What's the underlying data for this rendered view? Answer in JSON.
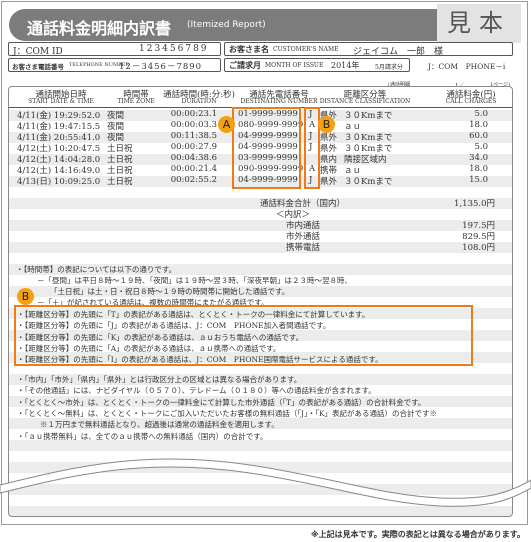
{
  "header": {
    "title": "通話料金明細内訳書",
    "subtitle": "(Itemized Report)",
    "sample_mark": "見本"
  },
  "info": {
    "jcom_id_label": "J：COM ID",
    "jcom_id_value": "123456789",
    "customer_label": "お客さま名",
    "customer_label_en": "CUSTOMER'S NAME",
    "customer_value": "ジェイコム　一郎　様",
    "phone_label": "お客さま電話番号",
    "phone_label_en": "TELEPHONE NUMBER",
    "phone_value": "12－3456－7890",
    "month_label": "ご請求月",
    "month_label_en": "MONTH OF ISSUE",
    "month_value": "2014年",
    "month_suffix": "5月請求分",
    "service": "J：COM　PHONE－i"
  },
  "page": {
    "section": "(通話明細",
    "current": "1／",
    "total": "1ページ)"
  },
  "columns": [
    {
      "ja": "通話開始日時",
      "en": "START DATE & TIME"
    },
    {
      "ja": "時間帯",
      "en": "TIME ZONE"
    },
    {
      "ja": "通話時間(時:分:秒)",
      "en": "DURATION"
    },
    {
      "ja": "通話先電話番号",
      "en": "DESTINATING NUMBER"
    },
    {
      "ja": "距離区分等",
      "en": "DISTANCE CLASSIFICATION"
    },
    {
      "ja": "通話料金(円)",
      "en": "CALL CHARGES"
    }
  ],
  "rows": [
    {
      "date": "4/11(金) 19:29:52.0",
      "zone": "夜間",
      "dur": "00:00:23.1",
      "num": "01-9999-9999",
      "code": "J",
      "area": "県外",
      "dist": "３０Kmまで",
      "charge": "5.0"
    },
    {
      "date": "4/11(金) 19:47:15.5",
      "zone": "夜間",
      "dur": "00:00:03.3",
      "num": "080-9999-9999",
      "code": "A",
      "area": "",
      "dist": "ａｕ",
      "charge": "18.0"
    },
    {
      "date": "4/11(金) 20:55:41.0",
      "zone": "夜間",
      "dur": "00:11:38.5",
      "num": "04-9999-9999",
      "code": "J",
      "area": "県外",
      "dist": "３０Kmまで",
      "charge": "60.0"
    },
    {
      "date": "4/12(土) 10:20:47.5",
      "zone": "土日祝",
      "dur": "00:00:27.9",
      "num": "04-9999-9999",
      "code": "J",
      "area": "県外",
      "dist": "３０Kmまで",
      "charge": "5.0"
    },
    {
      "date": "4/12(土) 14:04:28.0",
      "zone": "土日祝",
      "dur": "00:04:38.6",
      "num": "03-9999-9999",
      "code": "",
      "area": "県内",
      "dist": "隣接区域内",
      "charge": "34.0"
    },
    {
      "date": "4/12(土) 14:16:49.0",
      "zone": "土日祝",
      "dur": "00:00:21.4",
      "num": "090-9999-9999",
      "code": "A",
      "area": "携帯",
      "dist": "ａｕ",
      "charge": "18.0"
    },
    {
      "date": "4/13(日) 10:09:25.0",
      "zone": "土日祝",
      "dur": "00:02:55.2",
      "num": "04-9999-9999",
      "code": "J",
      "area": "県外",
      "dist": "３０Kmまで",
      "charge": "15.0"
    }
  ],
  "markers": {
    "a": "A",
    "b": "B"
  },
  "totals": {
    "total_label": "通話料金合計（国内）",
    "total_value": "1,135.0円",
    "breakdown_label": "＜内訳＞",
    "items": [
      {
        "label": "市内通話",
        "value": "197.5円"
      },
      {
        "label": "市外通話",
        "value": "829.5円"
      },
      {
        "label": "携帯電話",
        "value": "108.0円"
      }
    ]
  },
  "notes_time": [
    "・【時間帯】の表記については以下の通りです。",
    "－「昼間」は平日８時～１９時、「夜間」は１９時～翌３時、「深夜早朝」は２３時～翌８時、",
    "「土日祝」は土・日・祝日８時～１９時の時間帯に開始した通話です。",
    "－「＋」が記されている通話は、複数の時間帯にまたがる通話です。"
  ],
  "notes_class": [
    "・【距離区分等】の先頭に「T」の表記がある通話は、とくとく・トークの一律料金にて計算しています。",
    "・【距離区分等】の先頭に「J」の表記がある通話は、J：COM　PHONE加入者間通話です。",
    "・【距離区分等】の先頭に「K」の表記がある通話は、ａｕおうち電話への通話です。",
    "・【距離区分等】の先頭に「A」の表記がある通話は、ａｕ携帯への通話です。",
    "・【距離区分等】の先頭に「I」の表記がある通話は、J：COM　PHONE国際電話サービスによる通話です。"
  ],
  "notes_other": [
    "・「市内」「市外」「県内」「県外」とは行政区分上の区域とは異なる場合があります。",
    "・「その他通話」には、ナビダイヤル（０５７０）、テレドーム（０１８０）等への通話料金が含まれます。",
    "・「とくとく～市外」は、とくとく・トークの一律料金にて計算した市外通話（「T」の表記がある通話）の合計料金です。",
    "・「とくとく～無料」は、とくとく・トークにご加入いただいたお客様の無料通話（「J」・「K」表記がある通話）の合計です※",
    "※１万円まで無料通話となり、超過後は通常の通話料金を適用します。",
    "・「ａｕ携帯無料」は、全てのａｕ携帯への無料通話（国内）の合計です。"
  ],
  "footer": "※上記は見本です。実際の表記とは異なる場合があります。",
  "colors": {
    "accent": "#f07a1a",
    "marker": "#f5a00f",
    "title_bar": "#7c7c7c"
  }
}
